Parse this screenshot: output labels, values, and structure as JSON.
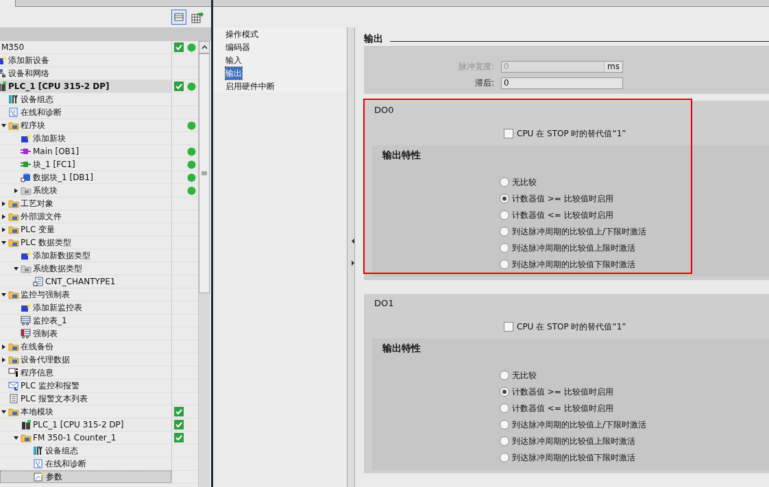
{
  "tree": {
    "items": [
      {
        "label": "M350",
        "kind": "root",
        "selected": false,
        "check": true,
        "dot": true,
        "children": [
          {
            "label": "添加新设备",
            "kind": "add",
            "selected": false,
            "check": false,
            "dot": false
          },
          {
            "label": "设备和网络",
            "kind": "network",
            "selected": false,
            "check": false,
            "dot": false
          },
          {
            "label": "PLC_1 [CPU 315-2 DP]",
            "kind": "device",
            "selected": false,
            "check": true,
            "dot": true,
            "children": [
              {
                "label": "设备组态",
                "kind": "config",
                "selected": false,
                "check": false,
                "dot": false
              },
              {
                "label": "在线和诊断",
                "kind": "diag",
                "selected": false,
                "check": false,
                "dot": false
              },
              {
                "label": "程序块",
                "kind": "folder",
                "expanded": true,
                "selected": false,
                "check": false,
                "dot": true,
                "children": [
                  {
                    "label": "添加新块",
                    "kind": "add",
                    "selected": false,
                    "check": false,
                    "dot": false
                  },
                  {
                    "label": "Main [OB1]",
                    "kind": "ob",
                    "selected": false,
                    "check": false,
                    "dot": true
                  },
                  {
                    "label": "块_1 [FC1]",
                    "kind": "fc",
                    "selected": false,
                    "check": false,
                    "dot": true
                  },
                  {
                    "label": "数据块_1 [DB1]",
                    "kind": "db",
                    "selected": false,
                    "check": false,
                    "dot": true
                  },
                  {
                    "label": "系统块",
                    "kind": "sysfolder",
                    "expanded": false,
                    "selected": false,
                    "check": false,
                    "dot": true
                  }
                ]
              },
              {
                "label": "工艺对象",
                "kind": "folder",
                "expanded": false,
                "selected": false,
                "check": false,
                "dot": false
              },
              {
                "label": "外部源文件",
                "kind": "folder",
                "expanded": false,
                "selected": false,
                "check": false,
                "dot": false
              },
              {
                "label": "PLC 变量",
                "kind": "folder",
                "expanded": false,
                "selected": false,
                "check": false,
                "dot": false
              },
              {
                "label": "PLC 数据类型",
                "kind": "folder",
                "expanded": true,
                "selected": false,
                "check": false,
                "dot": false,
                "children": [
                  {
                    "label": "添加新数据类型",
                    "kind": "add",
                    "selected": false,
                    "check": false,
                    "dot": false
                  },
                  {
                    "label": "系统数据类型",
                    "kind": "sysfolder",
                    "expanded": true,
                    "selected": false,
                    "check": false,
                    "dot": false,
                    "children": [
                      {
                        "label": "CNT_CHANTYPE1",
                        "kind": "datatype",
                        "selected": false,
                        "check": false,
                        "dot": false
                      }
                    ]
                  }
                ]
              },
              {
                "label": "监控与强制表",
                "kind": "folder",
                "expanded": true,
                "selected": false,
                "check": false,
                "dot": false,
                "children": [
                  {
                    "label": "添加新监控表",
                    "kind": "add",
                    "selected": false,
                    "check": false,
                    "dot": false
                  },
                  {
                    "label": "监控表_1",
                    "kind": "table",
                    "selected": false,
                    "check": false,
                    "dot": false
                  },
                  {
                    "label": "强制表",
                    "kind": "force",
                    "selected": false,
                    "check": false,
                    "dot": false
                  }
                ]
              },
              {
                "label": "在线备份",
                "kind": "folder",
                "expanded": false,
                "selected": false,
                "check": false,
                "dot": false
              },
              {
                "label": "设备代理数据",
                "kind": "folder",
                "expanded": false,
                "selected": false,
                "check": false,
                "dot": false
              },
              {
                "label": "程序信息",
                "kind": "info",
                "selected": false,
                "check": false,
                "dot": false
              },
              {
                "label": "PLC 监控和报警",
                "kind": "alarm",
                "selected": false,
                "check": false,
                "dot": false
              },
              {
                "label": "PLC 报警文本列表",
                "kind": "list",
                "selected": false,
                "check": false,
                "dot": false
              },
              {
                "label": "本地模块",
                "kind": "folder",
                "expanded": true,
                "selected": false,
                "check": true,
                "dot": false,
                "children": [
                  {
                    "label": "PLC_1 [CPU 315-2 DP]",
                    "kind": "device",
                    "selected": false,
                    "check": true,
                    "dot": false
                  },
                  {
                    "label": "FM 350-1 Counter_1",
                    "kind": "folder",
                    "expanded": true,
                    "selected": false,
                    "check": true,
                    "dot": false,
                    "children": [
                      {
                        "label": "设备组态",
                        "kind": "config",
                        "selected": false,
                        "check": false,
                        "dot": false
                      },
                      {
                        "label": "在线和诊断",
                        "kind": "diag",
                        "selected": false,
                        "check": false,
                        "dot": false
                      },
                      {
                        "label": "参数",
                        "kind": "params",
                        "selected": true,
                        "check": false,
                        "dot": false
                      }
                    ]
                  }
                ]
              }
            ]
          }
        ]
      }
    ]
  },
  "nav": {
    "items": [
      {
        "label": "操作模式",
        "selected": false
      },
      {
        "label": "编码器",
        "selected": false
      },
      {
        "label": "输入",
        "selected": false
      },
      {
        "label": "输出",
        "selected": true
      },
      {
        "label": "启用硬件中断",
        "selected": false
      }
    ]
  },
  "section_title": "输出",
  "general": {
    "fields": [
      {
        "label": "脉冲宽度:",
        "value": "0",
        "unit": "ms",
        "disabled": true
      },
      {
        "label": "滞后:",
        "value": "0",
        "disabled": false
      }
    ]
  },
  "channels": [
    {
      "title": "DO0",
      "highlighted": true,
      "checkbox": {
        "label": "CPU 在 STOP 时的替代值“1”",
        "checked": false
      },
      "group_title": "输出特性",
      "options": [
        {
          "label": "无比较",
          "selected": false
        },
        {
          "label": "计数器值 >= 比较值时启用",
          "selected": true
        },
        {
          "label": "计数器值 <= 比较值时启用",
          "selected": false
        },
        {
          "label": "到达脉冲周期的比较值上/下限时激活",
          "selected": false
        },
        {
          "label": "到达脉冲周期的比较值上限时激活",
          "selected": false
        },
        {
          "label": "到达脉冲周期的比较值下限时激活",
          "selected": false
        }
      ]
    },
    {
      "title": "DO1",
      "highlighted": false,
      "checkbox": {
        "label": "CPU 在 STOP 时的替代值“1”",
        "checked": false
      },
      "group_title": "输出特性",
      "options": [
        {
          "label": "无比较",
          "selected": false
        },
        {
          "label": "计数器值 >= 比较值时启用",
          "selected": true
        },
        {
          "label": "计数器值 <= 比较值时启用",
          "selected": false
        },
        {
          "label": "到达脉冲周期的比较值上/下限时激活",
          "selected": false
        },
        {
          "label": "到达脉冲周期的比较值上限时激活",
          "selected": false
        },
        {
          "label": "到达脉冲周期的比较值下限时激活",
          "selected": false
        }
      ]
    }
  ]
}
